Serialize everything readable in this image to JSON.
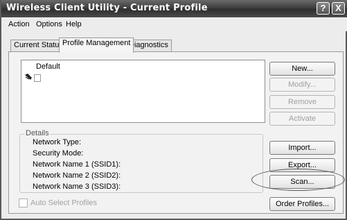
{
  "window": {
    "title": "Wireless Client Utility - Current Profile"
  },
  "title_buttons": {
    "help": "?",
    "close": "X"
  },
  "menus": [
    "Action",
    "Options",
    "Help"
  ],
  "tabs": [
    {
      "label": "Current Status",
      "active": false
    },
    {
      "label": "Profile Management",
      "active": true
    },
    {
      "label": "Diagnostics",
      "active": false
    }
  ],
  "profiles": [
    {
      "name": "Default"
    }
  ],
  "buttons": {
    "new": "New...",
    "modify": "Modify...",
    "remove": "Remove",
    "activate": "Activate",
    "import": "Import...",
    "export": "Export...",
    "scan": "Scan...",
    "order": "Order Profiles..."
  },
  "details": {
    "legend": "Details",
    "fields": [
      "Network Type:",
      "Security Mode:",
      "Network Name 1 (SSID1):",
      "Network Name 2 (SSID2):",
      "Network Name 3 (SSID3):"
    ]
  },
  "auto_select": {
    "label": "Auto Select Profiles",
    "checked": false
  }
}
